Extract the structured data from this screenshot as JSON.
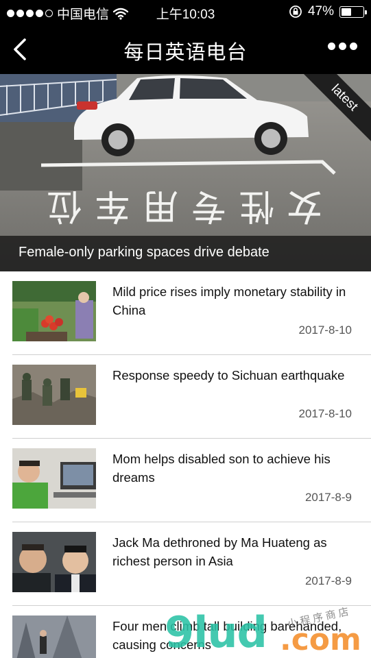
{
  "status_bar": {
    "carrier": "中国电信",
    "time": "上午10:03",
    "battery": "47%",
    "battery_level": 0.47,
    "signal_bars_filled": 4,
    "signal_bars_total": 5,
    "icons": [
      "signal-dots-icon",
      "wifi-icon",
      "orientation-lock-icon",
      "battery-icon"
    ]
  },
  "nav": {
    "title": "每日英语电台",
    "back_icon": "chevron-left-icon",
    "more_icon": "more-dots-icon"
  },
  "hero": {
    "caption": "Female-only parking spaces drive debate",
    "badge": "latest",
    "painted_text": "女性专用车位"
  },
  "news": [
    {
      "headline": "Mild price rises imply monetary stability in China",
      "date": "2017-8-10",
      "thumb": "market-vegetables"
    },
    {
      "headline": "Response speedy to Sichuan earthquake",
      "date": "2017-8-10",
      "thumb": "rescue-rubble"
    },
    {
      "headline": "Mom helps disabled son to achieve his dreams",
      "date": "2017-8-9",
      "thumb": "young-man-computer"
    },
    {
      "headline": "Jack Ma dethroned by Ma Huateng as richest person in Asia",
      "date": "2017-8-9",
      "thumb": "two-businessmen"
    },
    {
      "headline": "Four men climb tall building barehanded, causing concerns",
      "date": "",
      "thumb": "climber-skyscraper"
    }
  ],
  "watermark": {
    "brand": "9lud",
    "tld": ".com",
    "tagline": "小程序商店"
  },
  "colors": {
    "bar_background": "#000000",
    "caption_overlay": "#141414",
    "divider": "#cfcfcf",
    "date_text": "#555555"
  }
}
